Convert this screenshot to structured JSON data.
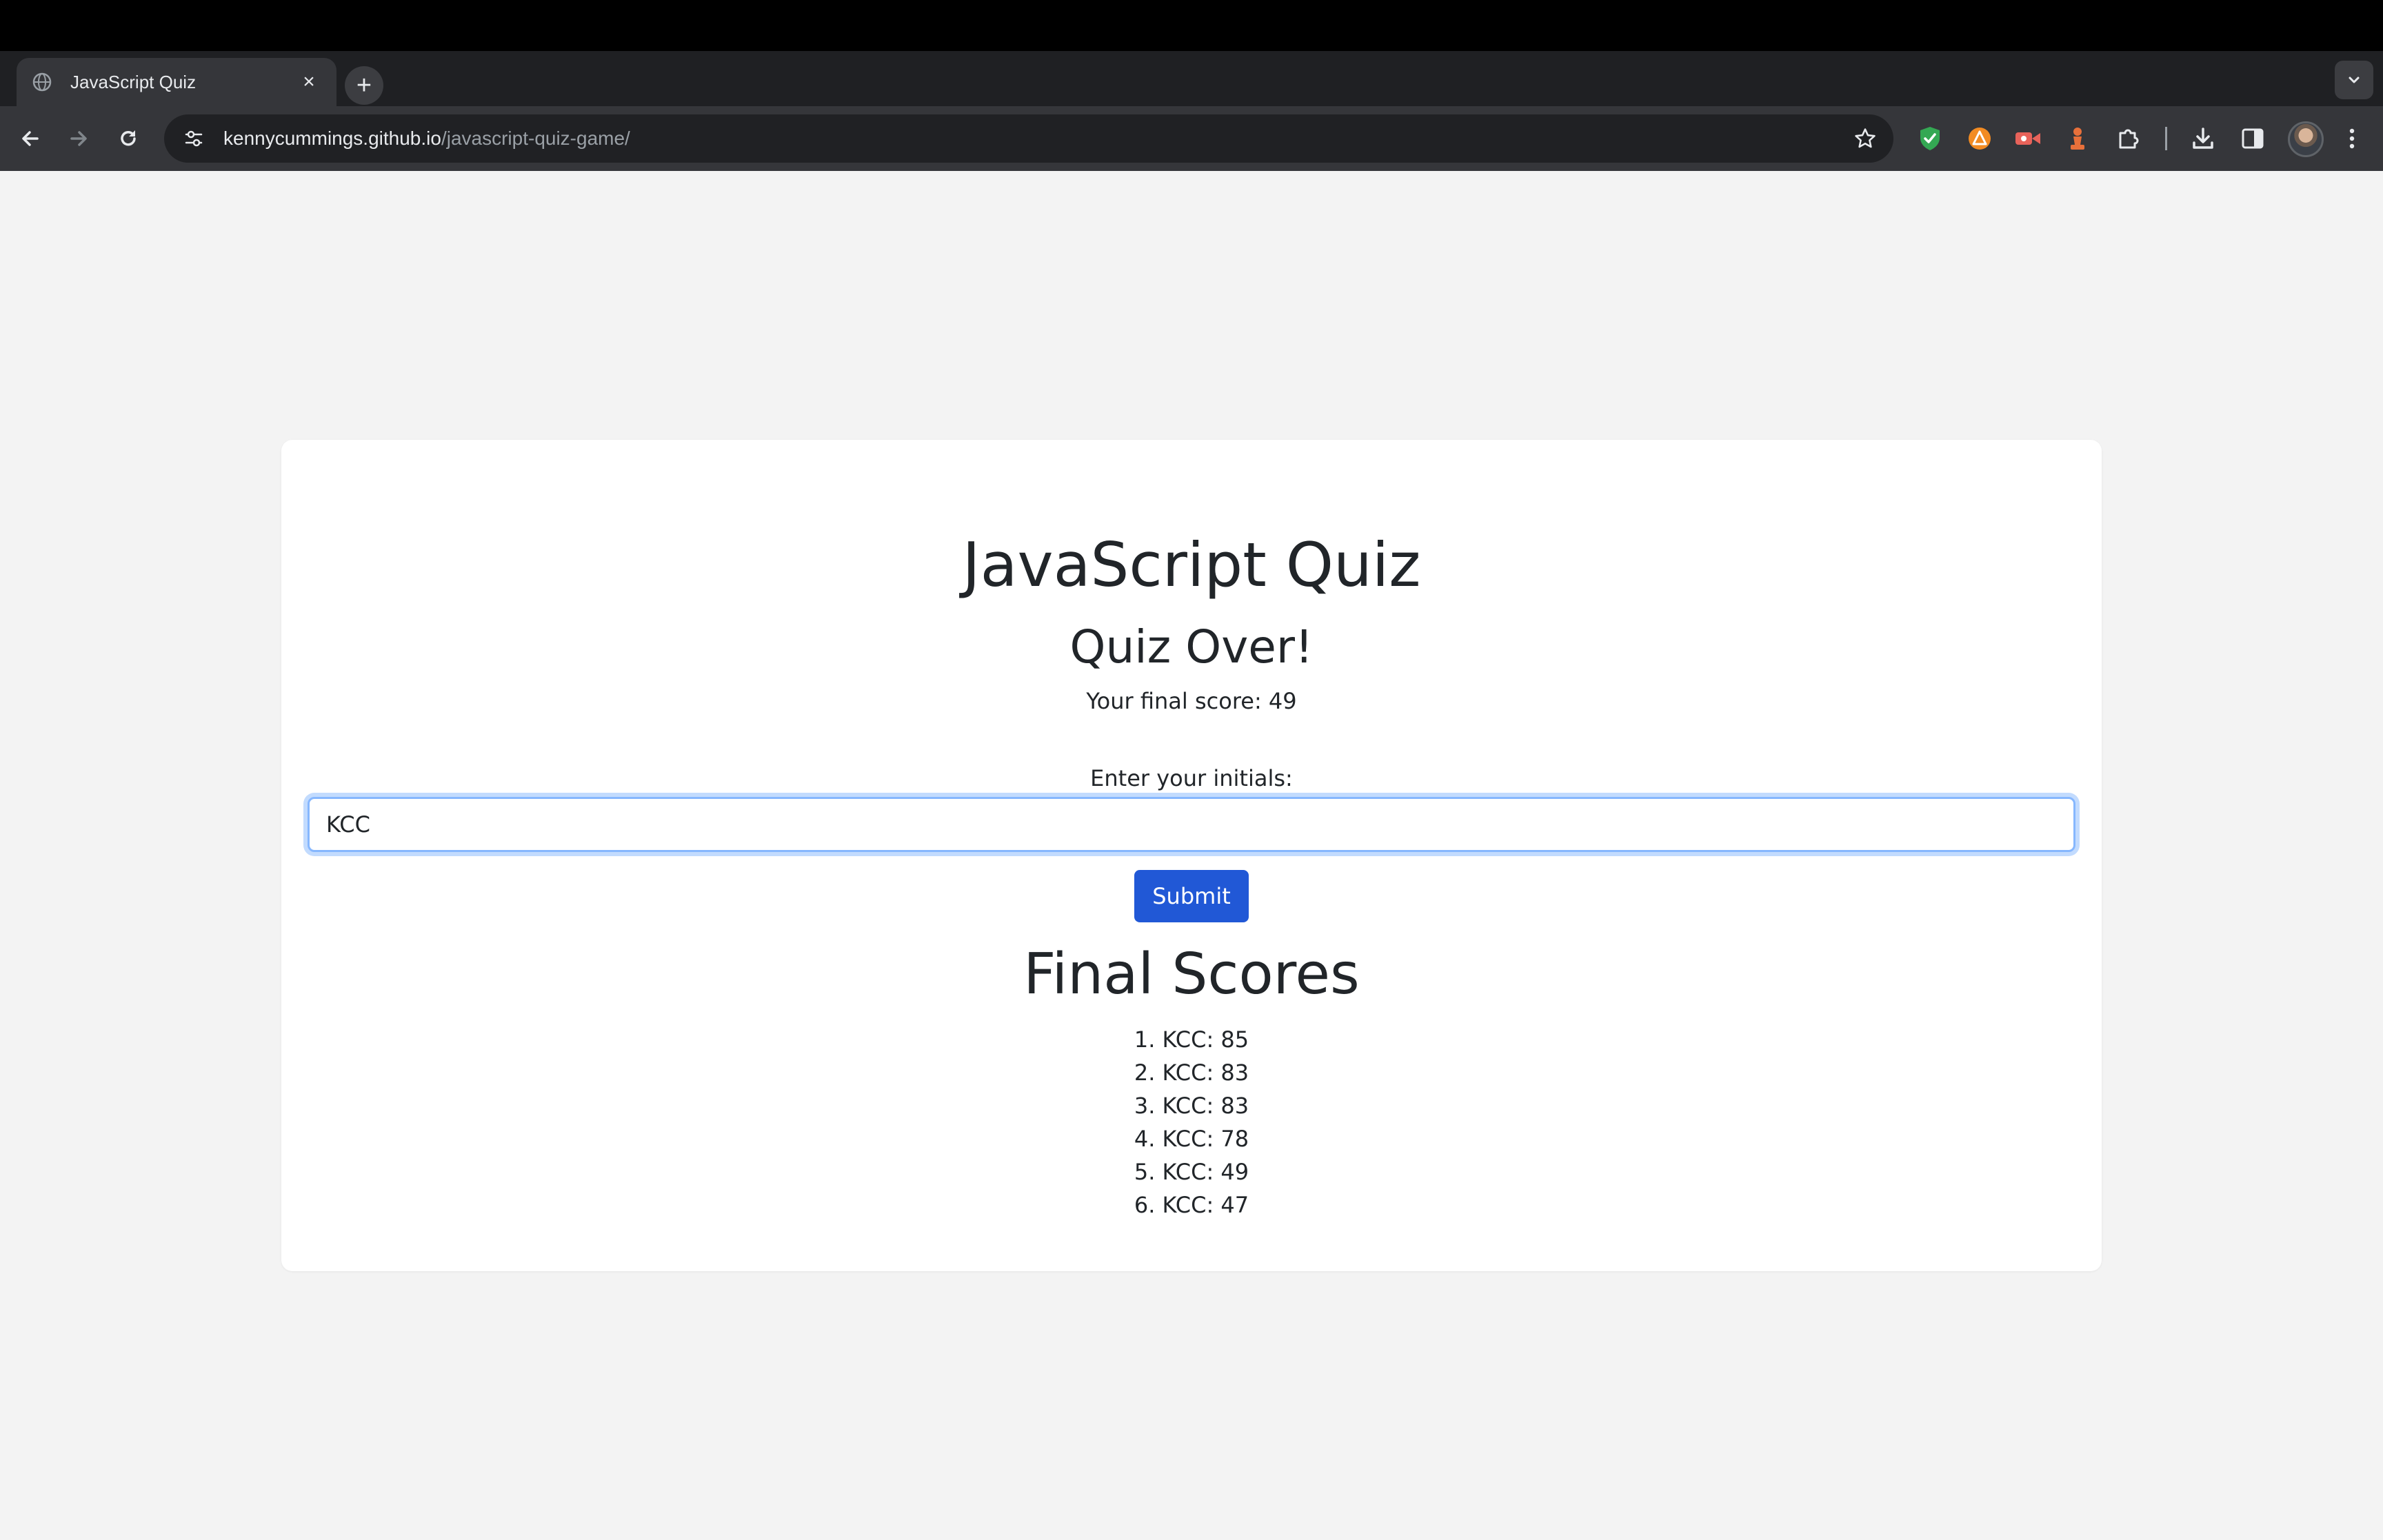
{
  "browser": {
    "tab_title": "JavaScript Quiz",
    "tab_close": "×",
    "new_tab": "+",
    "url_host": "kennycummings.github.io",
    "url_path": "/javascript-quiz-game/"
  },
  "quiz": {
    "title": "JavaScript Quiz",
    "over_heading": "Quiz Over!",
    "final_score_text": "Your final score: 49",
    "initials_label": "Enter your initials:",
    "initials_value": "KCC",
    "submit_label": "Submit",
    "scores_heading": "Final Scores",
    "scores": [
      "1. KCC: 85",
      "2. KCC: 83",
      "3. KCC: 83",
      "4. KCC: 78",
      "5. KCC: 49",
      "6. KCC: 47"
    ]
  },
  "colors": {
    "page_bg": "#f3f3f3",
    "primary_button": "#2158d6",
    "input_focus": "#86b7fe"
  },
  "icons": {
    "extensions": [
      "shield-check-icon",
      "brave-rewards-icon",
      "screen-recorder-icon",
      "chess-pawn-icon",
      "puzzle-extensions-icon"
    ]
  }
}
